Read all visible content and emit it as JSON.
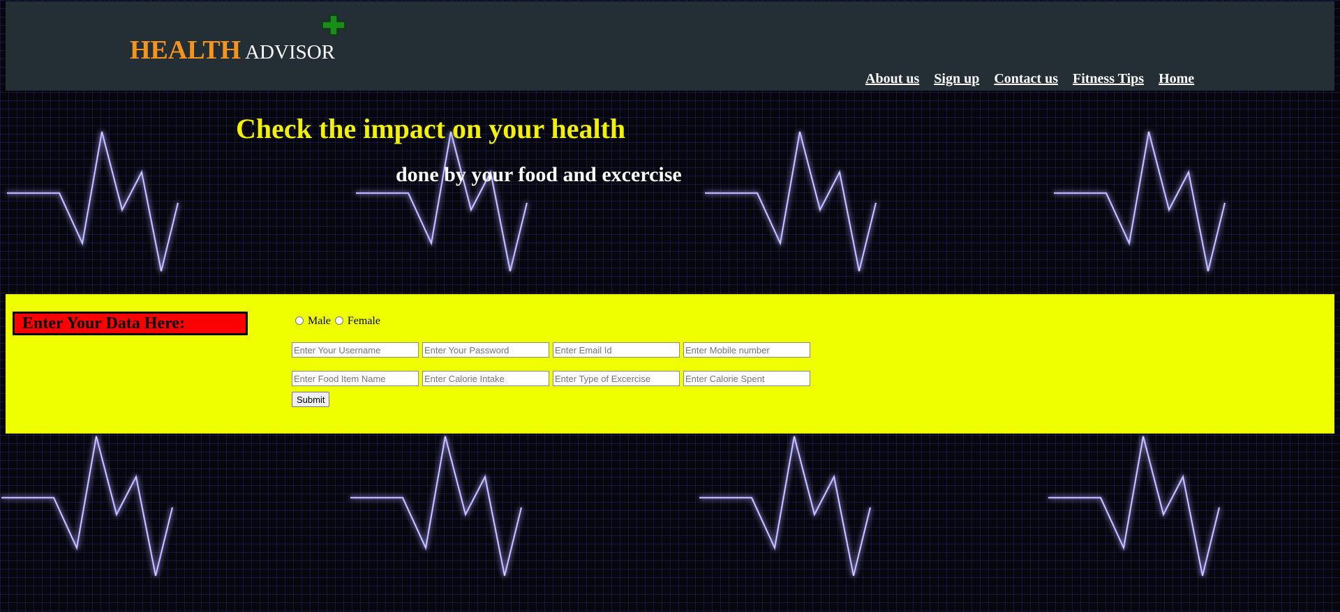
{
  "brand": {
    "health": "HEALTH",
    "advisor": "ADVISOR",
    "icon": "green-plus-icon"
  },
  "nav": [
    "About us",
    "Sign up",
    "Contact us",
    "Fitness Tips",
    "Home"
  ],
  "hero": {
    "title": "Check the impact on your health",
    "subtitle": "done by your food and excercise"
  },
  "form": {
    "section_label": "Enter Your Data Here:",
    "gender_options": [
      "Male",
      "Female"
    ],
    "row1_placeholders": [
      "Enter Your Username",
      "Enter Your Password",
      "Enter Email Id",
      "Enter Mobile number"
    ],
    "row2_placeholders": [
      "Enter Food Item Name",
      "Enter Calorie Intake",
      "Enter Type of Excercise",
      "Enter Calorie Spent"
    ],
    "submit_label": "Submit"
  },
  "colors": {
    "header_bg": "#242f35",
    "brand_orange": "#f7941d",
    "hero_title": "#f2f200",
    "form_panel": "#f0ff00",
    "label_bg": "#ff0000",
    "plus_icon": "#1a8c1a"
  }
}
